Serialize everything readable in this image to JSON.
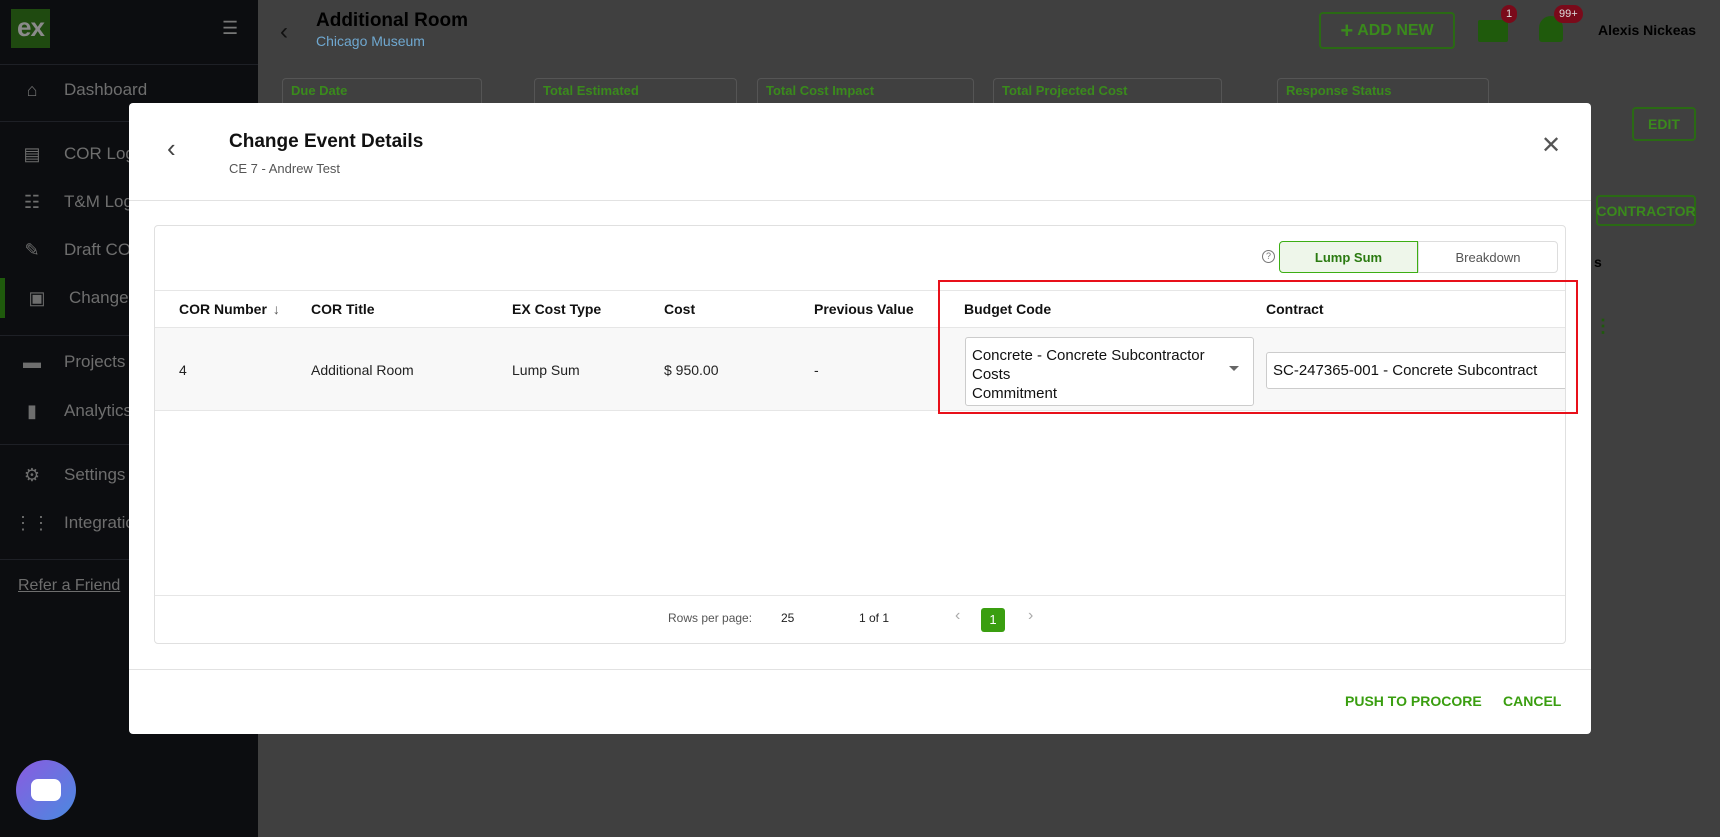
{
  "sidebar": {
    "logo": "ex",
    "items": [
      {
        "label": "Dashboard",
        "icon": "home-icon"
      },
      {
        "label": "COR Log",
        "icon": "document-icon"
      },
      {
        "label": "T&M Log",
        "icon": "list-icon"
      },
      {
        "label": "Draft COR",
        "icon": "pencil-icon"
      },
      {
        "label": "Change N",
        "icon": "clipboard-icon"
      },
      {
        "label": "Projects",
        "icon": "briefcase-icon"
      },
      {
        "label": "Analytics",
        "icon": "bar-chart-icon"
      },
      {
        "label": "Settings",
        "icon": "gear-icon"
      },
      {
        "label": "Integratio",
        "icon": "grid-icon"
      }
    ],
    "refer": "Refer a Friend"
  },
  "header": {
    "title": "Additional Room",
    "subtitle": "Chicago Museum",
    "add_new": "ADD NEW",
    "mail_badge": "1",
    "notif_badge": "99+",
    "user": "Alexis Nickeas"
  },
  "background": {
    "cards": [
      "Due Date",
      "Total Estimated",
      "Total Cost Impact",
      "Total Projected Cost",
      "Response Status"
    ],
    "edit": "EDIT",
    "contractor": "CONTRACTOR",
    "partial": "s"
  },
  "modal": {
    "title": "Change Event Details",
    "subtitle": "CE 7 - Andrew Test",
    "toggle": {
      "lump_sum": "Lump Sum",
      "breakdown": "Breakdown"
    },
    "columns": [
      "COR Number",
      "COR Title",
      "EX Cost Type",
      "Cost",
      "Previous Value",
      "Budget Code",
      "Contract"
    ],
    "row": {
      "cor_number": "4",
      "cor_title": "Additional Room",
      "cost_type": "Lump Sum",
      "cost": "$ 950.00",
      "previous_value": "-",
      "budget_code_line1": "Concrete - Concrete Subcontractor",
      "budget_code_line2": "Costs",
      "budget_code_line3": "Commitment",
      "contract": "SC-247365-001 - Concrete Subcontract"
    },
    "pagination": {
      "rows_label": "Rows per page:",
      "rows_value": "25",
      "range": "1 of 1",
      "page": "1"
    },
    "push": "PUSH TO PROCORE",
    "cancel": "CANCEL"
  },
  "colors": {
    "accent": "#3cae14",
    "highlight": "#e8101a"
  }
}
